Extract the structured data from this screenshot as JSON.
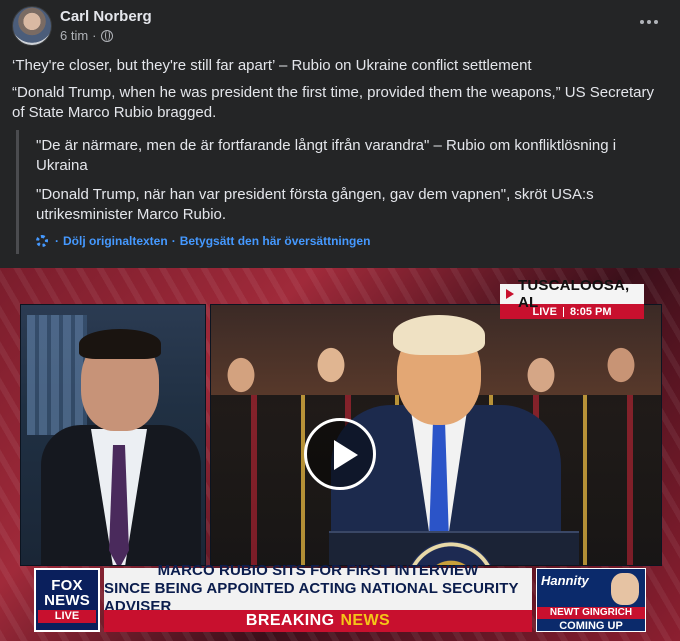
{
  "post": {
    "author": "Carl Norberg",
    "time": "6 tim",
    "separator": "·",
    "body": [
      "‘They're closer, but they're still far apart’ – Rubio on Ukraine conflict settlement",
      "“Donald Trump, when he was president the first time, provided them the weapons,” US Secretary of State Marco Rubio bragged."
    ],
    "translation": {
      "paragraphs": [
        "\"De är närmare, men de är fortfarande långt ifrån varandra\" – Rubio om konfliktlösning i Ukraina",
        "\"Donald Trump, när han var president första gången, gav dem vapnen\", skröt USA:s utrikesminister Marco Rubio."
      ],
      "hide_link": "Dölj originaltexten",
      "link_separator": "·",
      "rate_link": "Betygsätt den här översättningen"
    }
  },
  "video": {
    "location": "TUSCALOOSA, AL",
    "live_label": "LIVE",
    "live_time": "8:05 PM",
    "network_line1": "FOX",
    "network_line2": "NEWS",
    "network_live": "LIVE",
    "headline_line1": "MARCO RUBIO SITS FOR FIRST INTERVIEW",
    "headline_line2": "SINCE BEING APPOINTED ACTING NATIONAL SECURITY ADVISER",
    "breaking_word1": "BREAKING",
    "breaking_word2": "NEWS",
    "promo_show": "Hannity",
    "promo_guest": "NEWT GINGRICH",
    "promo_status": "COMING UP"
  },
  "icons": [
    "globe-icon",
    "more-options-icon",
    "gear-icon",
    "play-icon"
  ],
  "colors": {
    "background": "#242526",
    "text": "#e4e6eb",
    "secondary_text": "#b0b3b8",
    "link": "#4599ff",
    "fox_red": "#c8102e",
    "fox_navy": "#0a1f5c"
  }
}
